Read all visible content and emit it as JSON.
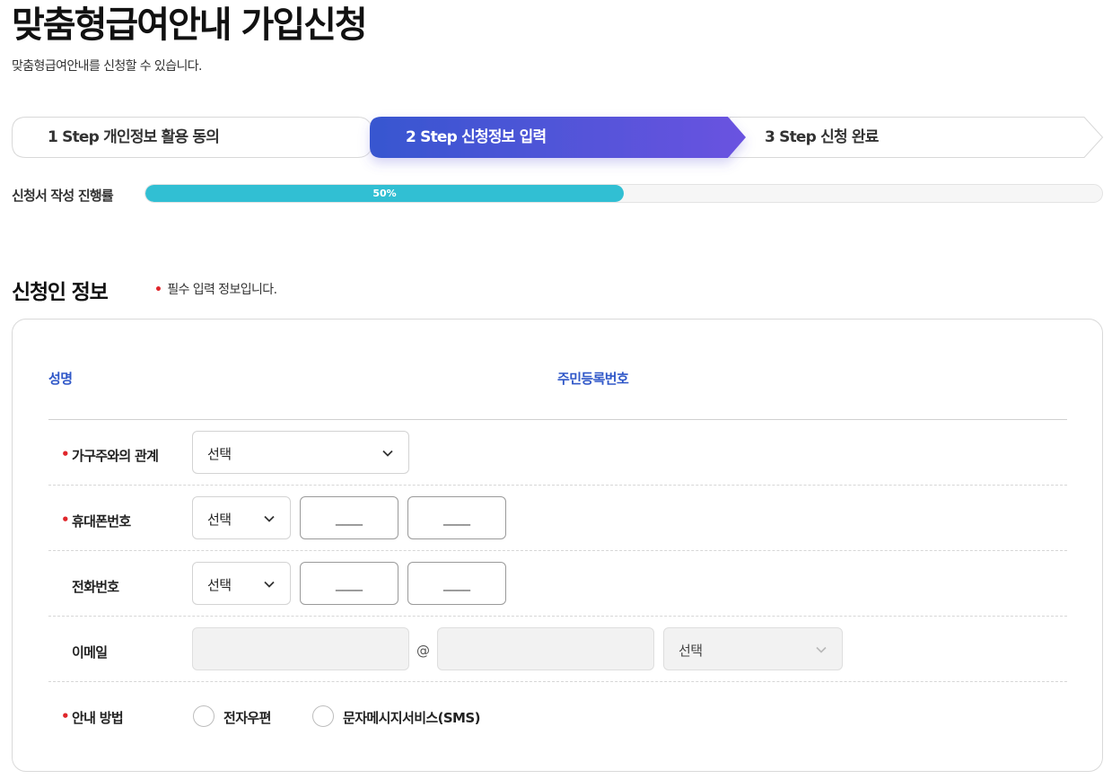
{
  "header": {
    "title": "맞춤형급여안내 가입신청",
    "subtitle": "맞춤형급여안내를 신청할 수 있습니다."
  },
  "steps": [
    {
      "label": "1 Step 개인정보 활용 동의",
      "active": false
    },
    {
      "label": "2 Step 신청정보 입력",
      "active": true
    },
    {
      "label": "3 Step 신청 완료",
      "active": false
    }
  ],
  "progress": {
    "label": "신청서 작성 진행률",
    "value_text": "50%",
    "value": 0.5
  },
  "section": {
    "title": "신청인 정보",
    "required_dot": "•",
    "required_note": "필수 입력 정보입니다."
  },
  "applicant": {
    "name_label": "성명",
    "rrn_label": "주민등록번호"
  },
  "form": {
    "relation": {
      "label": "가구주와의 관계",
      "select": "선택"
    },
    "mobile": {
      "label": "휴대폰번호",
      "select": "선택",
      "mid": "____",
      "last": "____"
    },
    "phone": {
      "label": "전화번호",
      "select": "선택",
      "mid": "____",
      "last": "____"
    },
    "email": {
      "label": "이메일",
      "local": "",
      "at": "@",
      "domain": "",
      "select": "선택"
    },
    "notice": {
      "label": "안내 방법",
      "options": [
        "전자우편",
        "문자메시지서비스(SMS)"
      ]
    }
  },
  "colors": {
    "step_active_start": "#3756d0",
    "step_active_end": "#6a52e0",
    "progress_fill": "#31bfd3",
    "required": "#e0262b",
    "info_label": "#2f57c8"
  },
  "icons": [
    "chevron-down-icon"
  ]
}
